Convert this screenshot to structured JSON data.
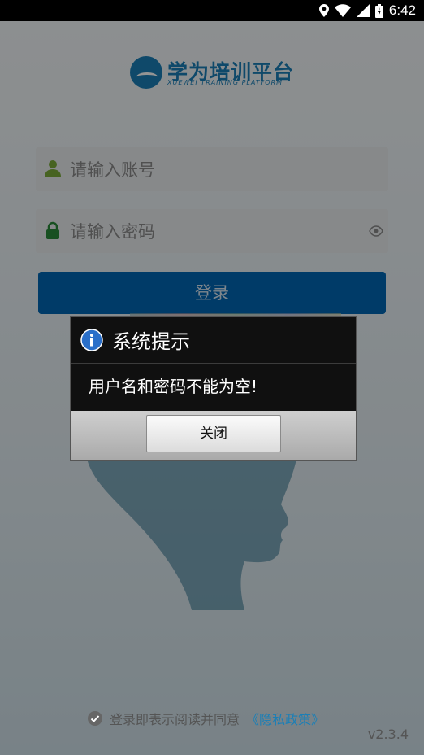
{
  "status_bar": {
    "time": "6:42"
  },
  "logo": {
    "title_cn": "学为培训平台",
    "title_en": "XUEWEI TRAINING PLATFORM"
  },
  "form": {
    "account_placeholder": "请输入账号",
    "password_placeholder": "请输入密码",
    "login_label": "登录"
  },
  "dialog": {
    "title": "系统提示",
    "message": "用户名和密码不能为空!",
    "close_label": "关闭"
  },
  "footer": {
    "agree_text": "登录即表示阅读并同意",
    "policy_link": "《隐私政策》",
    "version": "v2.3.4"
  },
  "colors": {
    "brand": "#1a7fb7",
    "login_button": "#0067b3"
  }
}
